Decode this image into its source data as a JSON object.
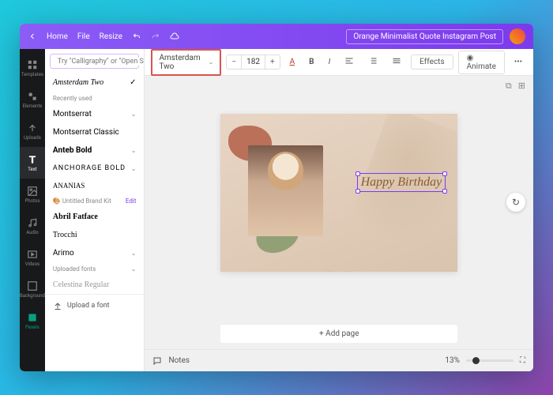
{
  "topbar": {
    "home": "Home",
    "file": "File",
    "resize": "Resize",
    "title": "Orange Minimalist Quote Instagram Post"
  },
  "rail": [
    {
      "key": "templates",
      "label": "Templates"
    },
    {
      "key": "elements",
      "label": "Elements"
    },
    {
      "key": "uploads",
      "label": "Uploads"
    },
    {
      "key": "text",
      "label": "Text"
    },
    {
      "key": "photos",
      "label": "Photos"
    },
    {
      "key": "audio",
      "label": "Audio"
    },
    {
      "key": "videos",
      "label": "Videos"
    },
    {
      "key": "background",
      "label": "Background"
    },
    {
      "key": "pexels",
      "label": "Pexels"
    }
  ],
  "search": {
    "placeholder": "Try \"Calligraphy\" or \"Open Sans\""
  },
  "fonts": {
    "current": "Amsterdam Two",
    "recent_head": "Recently used",
    "recent": [
      "Montserrat",
      "Montserrat Classic",
      "Anteb Bold",
      "ANCHORAGE BOLD",
      "ANANIAS"
    ],
    "brand_head": "Untitled Brand Kit",
    "brand_edit": "Edit",
    "brand": [
      "Abril Fatface",
      "Trocchi",
      "Arimo"
    ],
    "uploaded_head": "Uploaded fonts",
    "uploaded": [
      "Celestina Regular"
    ],
    "handwritten_sample": "Amsterdam Two",
    "upload": "Upload a font"
  },
  "toolbar": {
    "font_size": "182",
    "effects": "Effects",
    "animate": "Animate"
  },
  "canvas": {
    "text": "Happy Birthday"
  },
  "addpage": "+ Add page",
  "bottom": {
    "notes": "Notes",
    "zoom": "13%"
  }
}
